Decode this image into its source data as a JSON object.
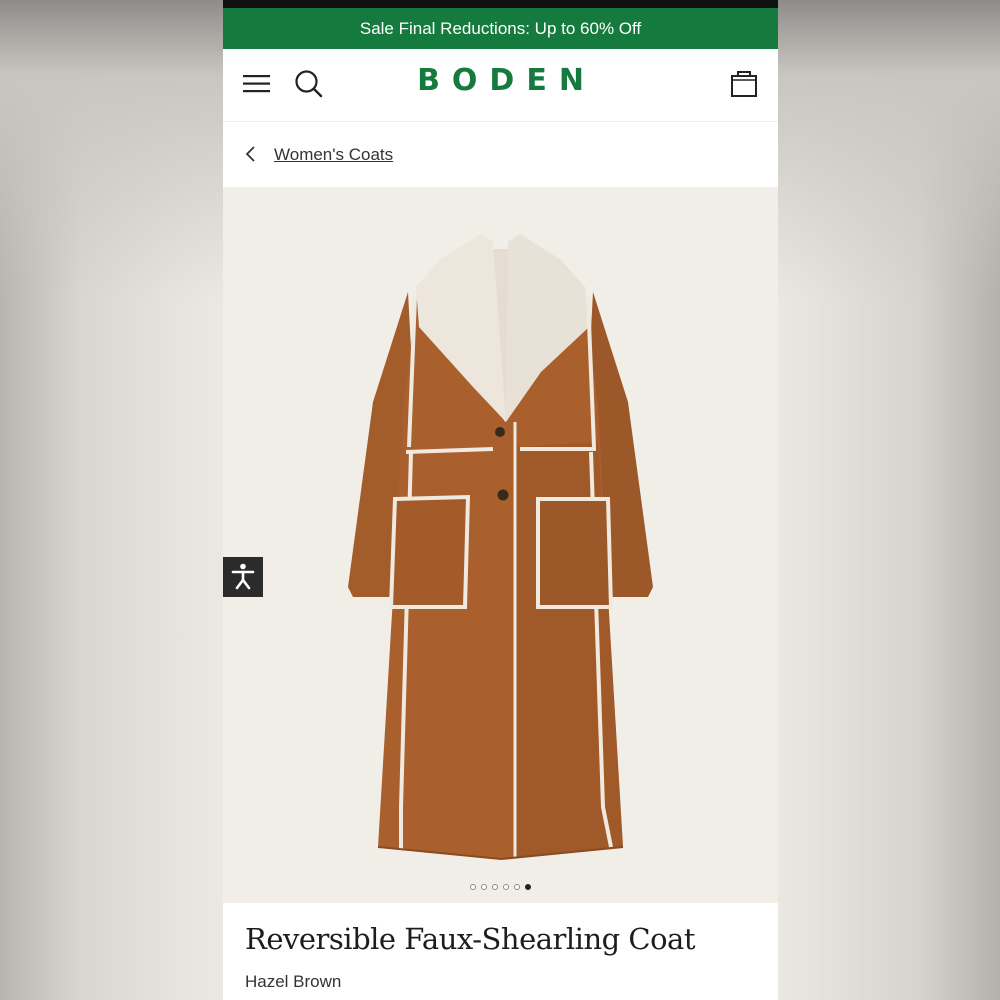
{
  "promo_banner": {
    "text": "Sale Final Reductions: Up to 60% Off"
  },
  "header": {
    "logo": "BODEN",
    "icons": [
      "menu-icon",
      "search-icon",
      "bag-icon"
    ]
  },
  "breadcrumb": {
    "label": "Women's Coats"
  },
  "gallery": {
    "total_images": 6,
    "active_index": 6
  },
  "product": {
    "title": "Reversible Faux-Shearling Coat",
    "color": "Hazel Brown"
  },
  "colors": {
    "brand_green": "#157a3d",
    "coat_brown": "#a35d2b",
    "shearling": "#ece6dd"
  }
}
